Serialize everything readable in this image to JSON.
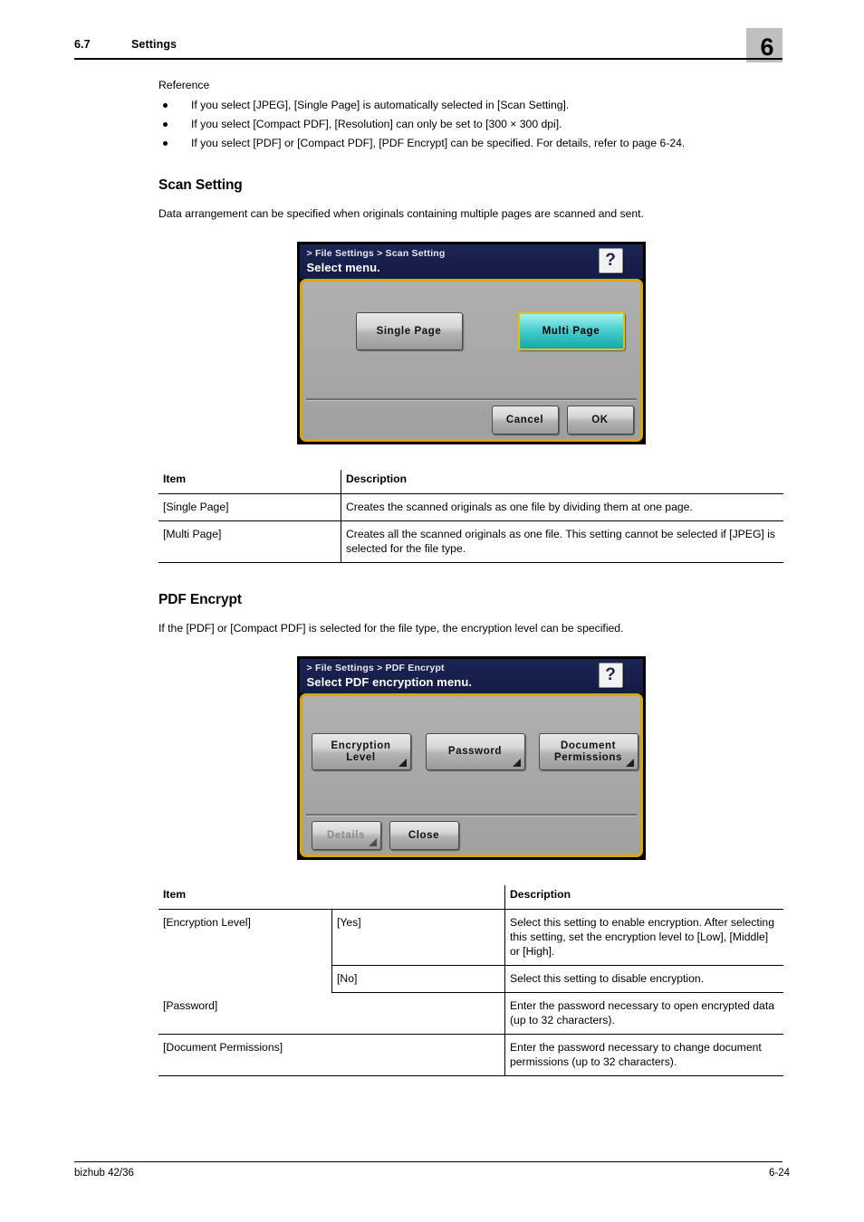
{
  "header": {
    "section_number": "6.7",
    "section_title": "Settings",
    "chapter_number": "6"
  },
  "reference": {
    "label": "Reference",
    "bullets": [
      "If you select [JPEG], [Single Page] is automatically selected in [Scan Setting].",
      "If you select [Compact PDF], [Resolution] can only be set to [300 × 300 dpi].",
      "If you select [PDF] or [Compact PDF], [PDF Encrypt] can be specified. For details, refer to page 6-24."
    ]
  },
  "scan_setting": {
    "heading": "Scan Setting",
    "description": "Data arrangement can be specified when originals containing multiple pages are scanned and sent.",
    "lcd": {
      "breadcrumb": "> File Settings > Scan Setting",
      "prompt": "Select menu.",
      "help_icon": "?",
      "buttons": {
        "single_page": "Single Page",
        "multi_page": "Multi Page",
        "cancel": "Cancel",
        "ok": "OK"
      }
    },
    "table": {
      "headers": [
        "Item",
        "Description"
      ],
      "rows": [
        {
          "item": "[Single Page]",
          "description": "Creates the scanned originals as one file by dividing them at one page."
        },
        {
          "item": "[Multi Page]",
          "description": "Creates all the scanned originals as one file. This setting cannot be selected if [JPEG] is selected for the file type."
        }
      ]
    }
  },
  "pdf_encrypt": {
    "heading": "PDF Encrypt",
    "description": "If the [PDF] or [Compact PDF] is selected for the file type, the encryption level can be specified.",
    "lcd": {
      "breadcrumb": "> File Settings > PDF Encrypt",
      "prompt": "Select PDF encryption menu.",
      "help_icon": "?",
      "buttons": {
        "encryption_level": "Encryption\nLevel",
        "encryption_level_line1": "Encryption",
        "encryption_level_line2": "Level",
        "password": "Password",
        "document_permissions_line1": "Document",
        "document_permissions_line2": "Permissions",
        "details": "Details",
        "close": "Close"
      }
    },
    "table": {
      "headers": [
        "Item",
        "Description"
      ],
      "rows": [
        {
          "item": "[Encryption Level]",
          "sub": "[Yes]",
          "description": "Select this setting to enable encryption. After selecting this setting, set the encryption level to [Low], [Middle] or [High]."
        },
        {
          "item": "",
          "sub": "[No]",
          "description": "Select this setting to disable encryption."
        },
        {
          "item": "[Password]",
          "sub": "",
          "description": "Enter the password necessary to open encrypted data (up to 32 characters)."
        },
        {
          "item": "[Document Permissions]",
          "sub": "",
          "description": "Enter the password necessary to change document permissions (up to 32 characters)."
        }
      ]
    }
  },
  "footer": {
    "product": "bizhub 42/36",
    "page_number": "6-24"
  },
  "colors": {
    "lcd_title_bg": "#1a2250",
    "lcd_border_gold": "#d8a800",
    "lcd_panel_bg": "#a8a8a8",
    "selected_button_teal": "#19b0b0",
    "chapter_box_gray": "#bfbfbf"
  }
}
